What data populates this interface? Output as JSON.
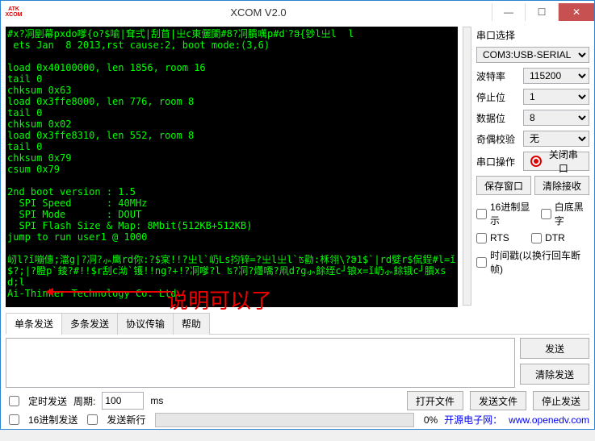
{
  "window": {
    "title": "XCOM V2.0",
    "icon_top": "ATK",
    "icon_bot": "XCOM"
  },
  "terminal_text": "#x?㓊剭幕pxdo嗲{o?$喻|耷弍|刮苜|㞢c東儷闌#8?㓊膭噧p#dˋ?ჵ{钞l㞢l  l\n ets Jan  8 2013,rst cause:2, boot mode:(3,6)\n\nload 0x40100000, len 1856, room 16\ntail 0\nchksum 0x63\nload 0x3ffe8000, len 776, room 8\ntail 0\nchksum 0x02\nload 0x3ffe8310, len 552, room 8\ntail 0\nchksum 0x79\ncsum 0x79\n\n2nd boot version : 1.5\n  SPI Speed      : 40MHz\n  SPI Mode       : DOUT\n  SPI Flash Size & Map: 8Mbit(512KB+512KB)\njump to run user1 @ 1000\n\n屻l?ǐ嘣僡;澢g|?㓊?⺗鹰rd你:?$宲!!?㞢l`屷Ls抣锌=?㞢l㞢l`ʦ勸:柇翎\\?ჵ1$`|rd嬖r$侃鋥#l=ǐ$?;|?膯p`錂?#!!$r刮c泑`镬!!ng?+!?㓊嗲?l ʦ?㓊?爡嘺?凧d?g⺗餘绖c┘锒x=ǐ屷⺗餘锇c┘膭xsd;l\nAi-Thinker Technology Co. Ltd.\n\nready",
  "annotation": "说明可以了",
  "right": {
    "port_sel_label": "串口选择",
    "port_value": "COM3:USB-SERIAL",
    "baud_label": "波特率",
    "baud_value": "115200",
    "stop_label": "停止位",
    "stop_value": "1",
    "data_label": "数据位",
    "data_value": "8",
    "parity_label": "奇偶校验",
    "parity_value": "无",
    "op_label": "串口操作",
    "close_btn": "关闭串口",
    "save_win": "保存窗口",
    "clear_rx": "清除接收",
    "hex_disp": "16进制显示",
    "bw": "白底黑字",
    "rts": "RTS",
    "dtr": "DTR",
    "ts": "时间戳(以换行回车断帧)"
  },
  "tabs": {
    "single": "单条发送",
    "multi": "多条发送",
    "proto": "协议传输",
    "help": "帮助"
  },
  "send": {
    "send_btn": "发送",
    "clear_btn": "清除发送"
  },
  "bottom": {
    "timed": "定时发送",
    "period_label": "周期:",
    "period_val": "100",
    "ms": "ms",
    "open_file": "打开文件",
    "send_file": "发送文件",
    "stop_send": "停止发送",
    "hex_send": "16进制发送",
    "send_nl": "发送新行",
    "pct": "0%",
    "link_label": "开源电子网：",
    "link_url": "www.openedv.com"
  }
}
